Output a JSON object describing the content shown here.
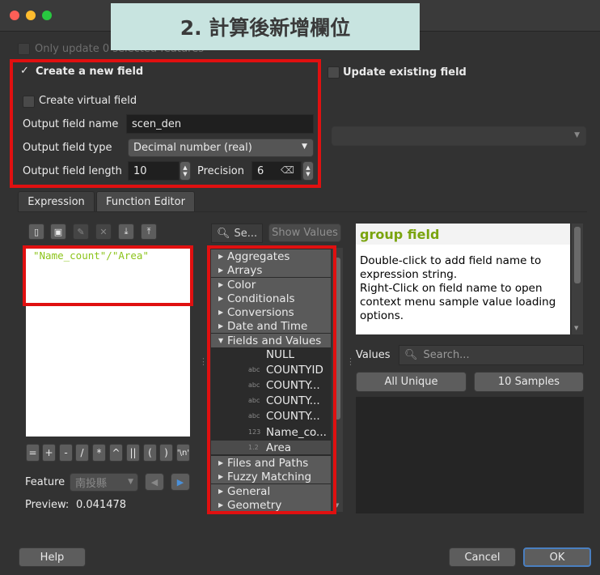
{
  "banner": "2. 計算後新增欄位",
  "only_update": "Only update 0 selected features",
  "create_new_field": {
    "label": "Create a new field",
    "virtual_label": "Create virtual field",
    "output_name_label": "Output field name",
    "output_name_value": "scen_den",
    "output_type_label": "Output field type",
    "output_type_value": "Decimal number (real)",
    "output_length_label": "Output field length",
    "output_length_value": "10",
    "precision_label": "Precision",
    "precision_value": "6"
  },
  "update_existing": {
    "label": "Update existing field"
  },
  "tabs": [
    "Expression",
    "Function Editor"
  ],
  "expression": "\"Name_count\"/\"Area\"",
  "operators": [
    "=",
    "+",
    "-",
    "/",
    "*",
    "^",
    "||",
    "(",
    ")",
    "'\\n'"
  ],
  "feature": {
    "label": "Feature",
    "value": "南投縣"
  },
  "preview": {
    "label": "Preview:",
    "value": "0.041478"
  },
  "function_search": {
    "placeholder": "Se...",
    "show_values": "Show Values"
  },
  "tree": {
    "groups_top": [
      "Aggregates",
      "Arrays",
      "Color",
      "Conditionals",
      "Conversions",
      "Date and Time"
    ],
    "expanded_group": "Fields and Values",
    "fields": [
      {
        "badge": "",
        "name": "NULL"
      },
      {
        "badge": "abc",
        "name": "COUNTYID"
      },
      {
        "badge": "abc",
        "name": "COUNTY..."
      },
      {
        "badge": "abc",
        "name": "COUNTY..."
      },
      {
        "badge": "abc",
        "name": "COUNTY..."
      },
      {
        "badge": "123",
        "name": "Name_co..."
      },
      {
        "badge": "1.2",
        "name": "Area"
      }
    ],
    "groups_bottom": [
      "Files and Paths",
      "Fuzzy Matching",
      "General",
      "Geometry"
    ]
  },
  "help": {
    "title": "group field",
    "body": "Double-click to add field name to expression string.\nRight-Click on field name to open context menu sample value loading options."
  },
  "values": {
    "label": "Values",
    "search_placeholder": "Search...",
    "all_unique": "All Unique",
    "samples": "10 Samples"
  },
  "buttons": {
    "help": "Help",
    "cancel": "Cancel",
    "ok": "OK"
  },
  "colors": {
    "accent_red": "#e01010",
    "banner_bg": "#c8e4e0",
    "help_title": "#7aa40e",
    "expr_text": "#8cc41b"
  }
}
